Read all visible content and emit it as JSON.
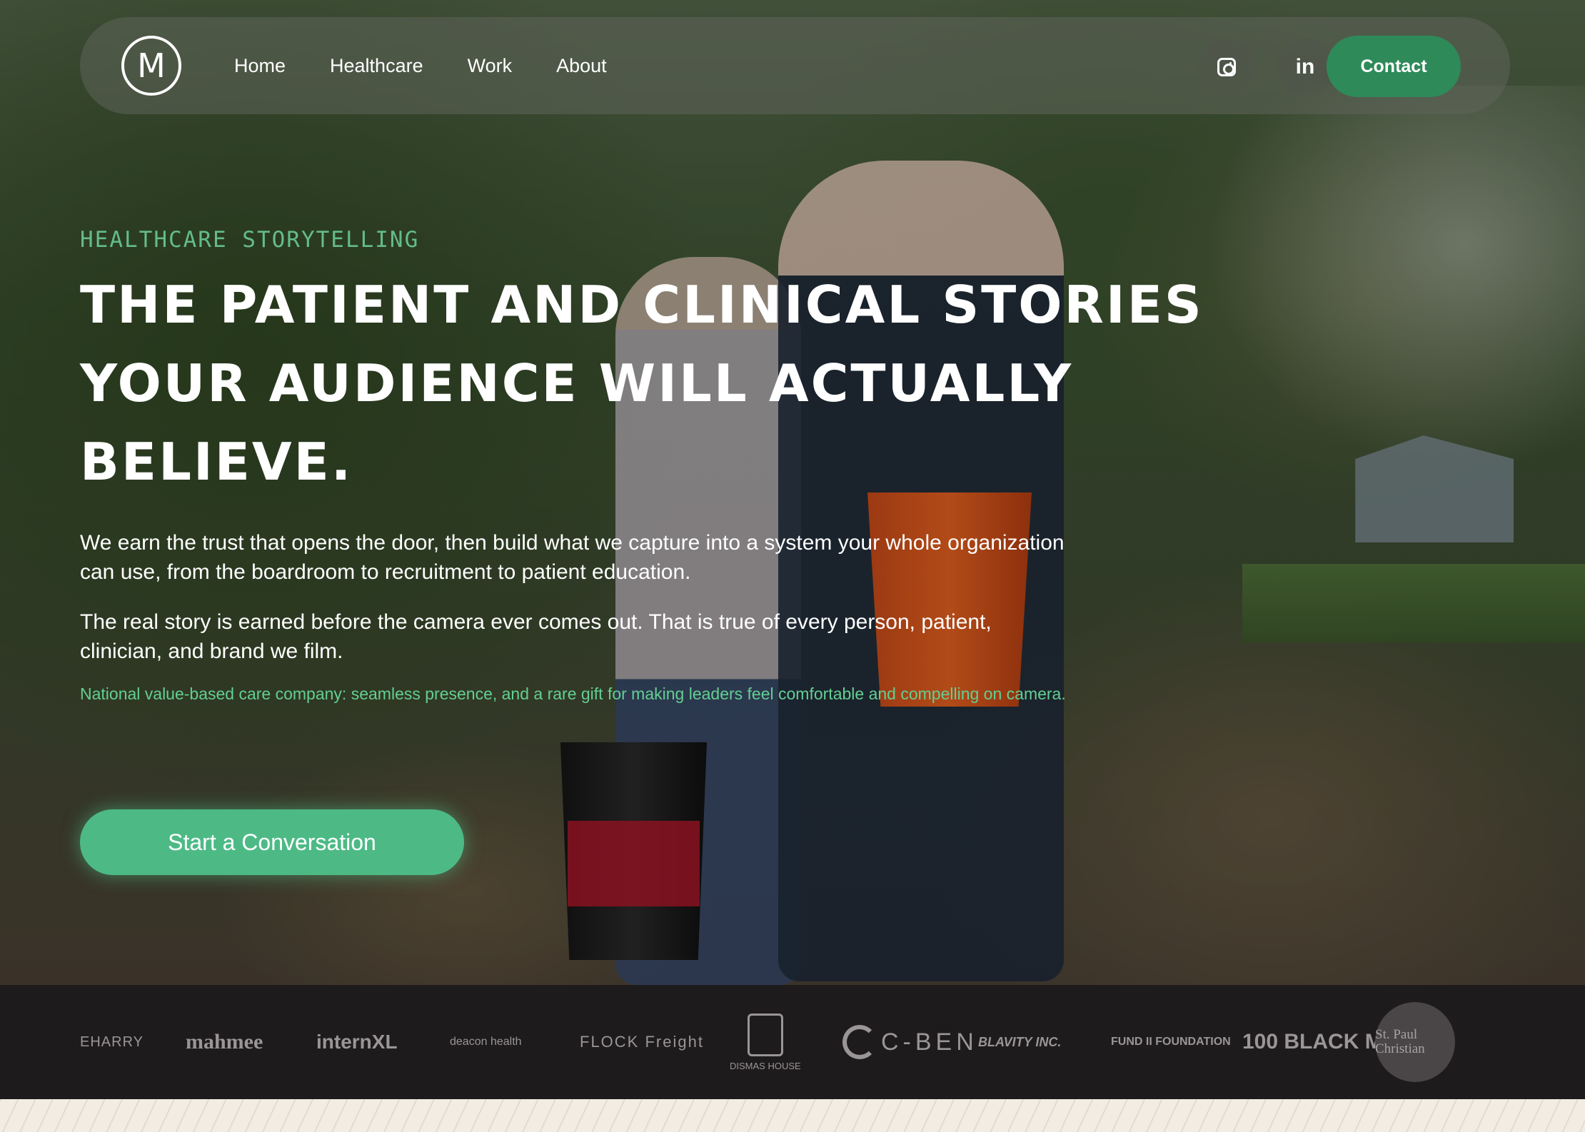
{
  "nav": {
    "logo_text": "M",
    "links": [
      "Home",
      "Healthcare",
      "Work",
      "About"
    ],
    "social": [
      "instagram-icon",
      "linkedin-icon"
    ],
    "linkedin_label": "in",
    "contact_label": "Contact"
  },
  "hero": {
    "eyebrow": "HEALTHCARE STORYTELLING",
    "headline_lines": [
      "THE PATIENT AND CLINICAL STORIES",
      "YOUR AUDIENCE WILL ACTUALLY",
      "BELIEVE."
    ],
    "paragraph_1": "We earn the trust that opens the door, then build what we capture into a system your whole organization can use, from the boardroom to recruitment to patient education.",
    "paragraph_2": "The real story is earned before the camera ever comes out. That is true of every person, patient, clinician, and brand we film.",
    "testimonial": "National value-based care company: seamless presence, and a rare gift for making leaders feel comfortable and compelling on camera.",
    "cta_label": "Start a Conversation"
  },
  "clients": [
    "EHARRY",
    "mahmee",
    "internXL",
    "deacon health",
    "FLOCK Freight",
    "DISMAS HOUSE",
    "C-BEN",
    "BLAVITY INC.",
    "FUND II FOUNDATION",
    "100 BLACK MEN",
    "St. Paul Christian"
  ],
  "colors": {
    "accent_green": "#2f8a59",
    "cta_green": "#4dba86",
    "eyebrow_green": "#6fd39b",
    "strip_bg": "#1e1b1c",
    "band_bg": "#f3ece3"
  }
}
